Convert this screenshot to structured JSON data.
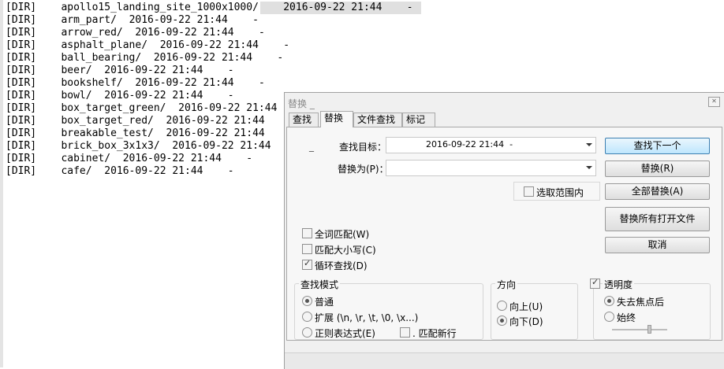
{
  "editor": {
    "lines": [
      {
        "tag": "[DIR]",
        "name": "apollo15_landing_site_1000x1000/",
        "date": "2016-09-22 21:44",
        "size": "-"
      },
      {
        "tag": "[DIR]",
        "name": "arm_part/",
        "date": "2016-09-22 21:44",
        "size": "-"
      },
      {
        "tag": "[DIR]",
        "name": "arrow_red/",
        "date": "2016-09-22 21:44",
        "size": "-"
      },
      {
        "tag": "[DIR]",
        "name": "asphalt_plane/",
        "date": "2016-09-22 21:44",
        "size": "-"
      },
      {
        "tag": "[DIR]",
        "name": "ball_bearing/",
        "date": "2016-09-22 21:44",
        "size": "-"
      },
      {
        "tag": "[DIR]",
        "name": "beer/",
        "date": "2016-09-22 21:44",
        "size": "-"
      },
      {
        "tag": "[DIR]",
        "name": "bookshelf/",
        "date": "2016-09-22 21:44",
        "size": "-"
      },
      {
        "tag": "[DIR]",
        "name": "bowl/",
        "date": "2016-09-22 21:44",
        "size": "-"
      },
      {
        "tag": "[DIR]",
        "name": "box_target_green/",
        "date": "2016-09-22 21:44",
        "size": ""
      },
      {
        "tag": "[DIR]",
        "name": "box_target_red/",
        "date": "2016-09-22 21:44",
        "size": ""
      },
      {
        "tag": "[DIR]",
        "name": "breakable_test/",
        "date": "2016-09-22 21:44",
        "size": ""
      },
      {
        "tag": "[DIR]",
        "name": "brick_box_3x1x3/",
        "date": "2016-09-22 21:44",
        "size": ""
      },
      {
        "tag": "[DIR]",
        "name": "cabinet/",
        "date": "2016-09-22 21:44",
        "size": "-"
      },
      {
        "tag": "[DIR]",
        "name": "cafe/",
        "date": "2016-09-22 21:44",
        "size": "-"
      }
    ]
  },
  "dialog": {
    "title": "替换 _",
    "close_glyph": "✕",
    "tabs": [
      "查找",
      "替换",
      "文件查找",
      "标记"
    ],
    "active_tab": "替换",
    "find_label": "查找目标：",
    "find_value": "2016-09-22 21:44  -",
    "find_prefix": "_",
    "replace_label": "替换为(P)：",
    "replace_value": "",
    "buttons": {
      "find_next": "查找下一个",
      "replace": "替换(R)",
      "replace_all": "全部替换(A)",
      "replace_all_open": "替换所有打开文件",
      "cancel": "取消"
    },
    "in_selection": "选取范围内",
    "options": {
      "whole_word": "全词匹配(W)",
      "match_case": "匹配大小写(C)",
      "wrap_around": "循环查找(D)"
    },
    "search_mode": {
      "title": "查找模式",
      "normal": "普通",
      "extended": "扩展 (\\n, \\r, \\t, \\0, \\x...)",
      "regex": "正则表达式(E)",
      "dot_newline": ". 匹配新行"
    },
    "direction": {
      "title": "方向",
      "up": "向上(U)",
      "down": "向下(D)"
    },
    "transparency": {
      "title": "透明度",
      "on_lose_focus": "失去焦点后",
      "always": "始终"
    }
  }
}
